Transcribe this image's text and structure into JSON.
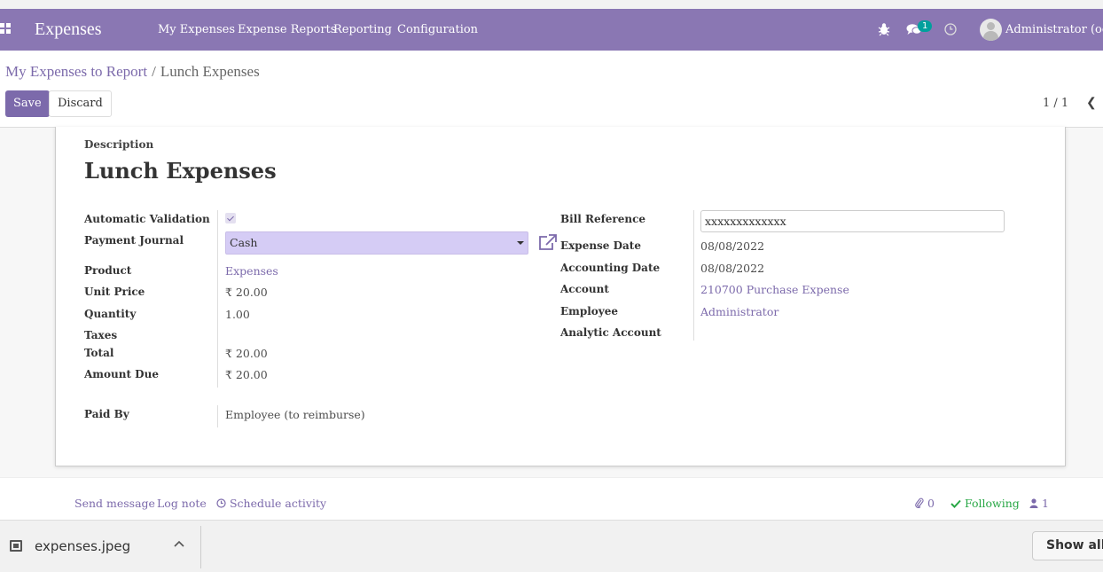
{
  "navbar": {
    "app_name": "Expenses",
    "menu": [
      "My Expenses",
      "Expense Reports",
      "Reporting",
      "Configuration"
    ],
    "message_badge": "1",
    "user": "Administrator (odoo-"
  },
  "breadcrumb": {
    "parent": "My Expenses to Report",
    "separator": "/",
    "current": "Lunch Expenses"
  },
  "buttons": {
    "save": "Save",
    "discard": "Discard"
  },
  "pager": {
    "text": "1 / 1",
    "prev": "❮"
  },
  "form": {
    "description_label": "Description",
    "description": "Lunch Expenses",
    "left": {
      "automatic_validation_label": "Automatic Validation",
      "payment_journal_label": "Payment Journal",
      "payment_journal": "Cash",
      "product_label": "Product",
      "product": "Expenses",
      "unit_price_label": "Unit Price",
      "unit_price": "₹ 20.00",
      "quantity_label": "Quantity",
      "quantity": "1.00",
      "taxes_label": "Taxes",
      "total_label": "Total",
      "total": "₹ 20.00",
      "amount_due_label": "Amount Due",
      "amount_due": "₹ 20.00",
      "paid_by_label": "Paid By",
      "paid_by": "Employee (to reimburse)"
    },
    "right": {
      "bill_reference_label": "Bill Reference",
      "bill_reference": "xxxxxxxxxxxxx",
      "expense_date_label": "Expense Date",
      "expense_date": "08/08/2022",
      "accounting_date_label": "Accounting Date",
      "accounting_date": "08/08/2022",
      "account_label": "Account",
      "account": "210700 Purchase Expense",
      "employee_label": "Employee",
      "employee": "Administrator",
      "analytic_account_label": "Analytic Account"
    }
  },
  "chatter": {
    "send_message": "Send message",
    "log_note": "Log note",
    "schedule_activity": "Schedule activity",
    "attachments": "0",
    "following": "Following",
    "followers": "1"
  },
  "download_bar": {
    "file_name": "expenses.jpeg",
    "show_all": "Show all"
  },
  "colors": {
    "brand": "#8a77b3",
    "link": "#7c6aab",
    "following": "#28a745",
    "select_bg": "#d5ccf5"
  }
}
